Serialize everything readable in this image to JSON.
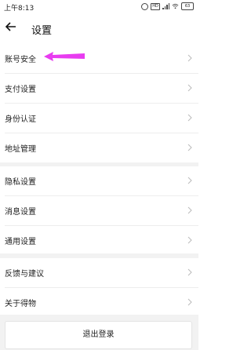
{
  "status": {
    "time": "上午8:13",
    "sim_icon_text": "HD",
    "battery_text": "63"
  },
  "header": {
    "title": "设置"
  },
  "groups": [
    {
      "items": [
        {
          "label": "账号安全"
        },
        {
          "label": "支付设置"
        },
        {
          "label": "身份认证"
        },
        {
          "label": "地址管理"
        }
      ]
    },
    {
      "items": [
        {
          "label": "隐私设置"
        },
        {
          "label": "消息设置"
        },
        {
          "label": "通用设置"
        }
      ]
    },
    {
      "items": [
        {
          "label": "反馈与建议"
        },
        {
          "label": "关于得物"
        }
      ]
    }
  ],
  "logout_label": "退出登录",
  "colors": {
    "annotation_arrow": "#e83cf0",
    "divider": "#ededed",
    "section_gap": "#f2f2f2"
  }
}
